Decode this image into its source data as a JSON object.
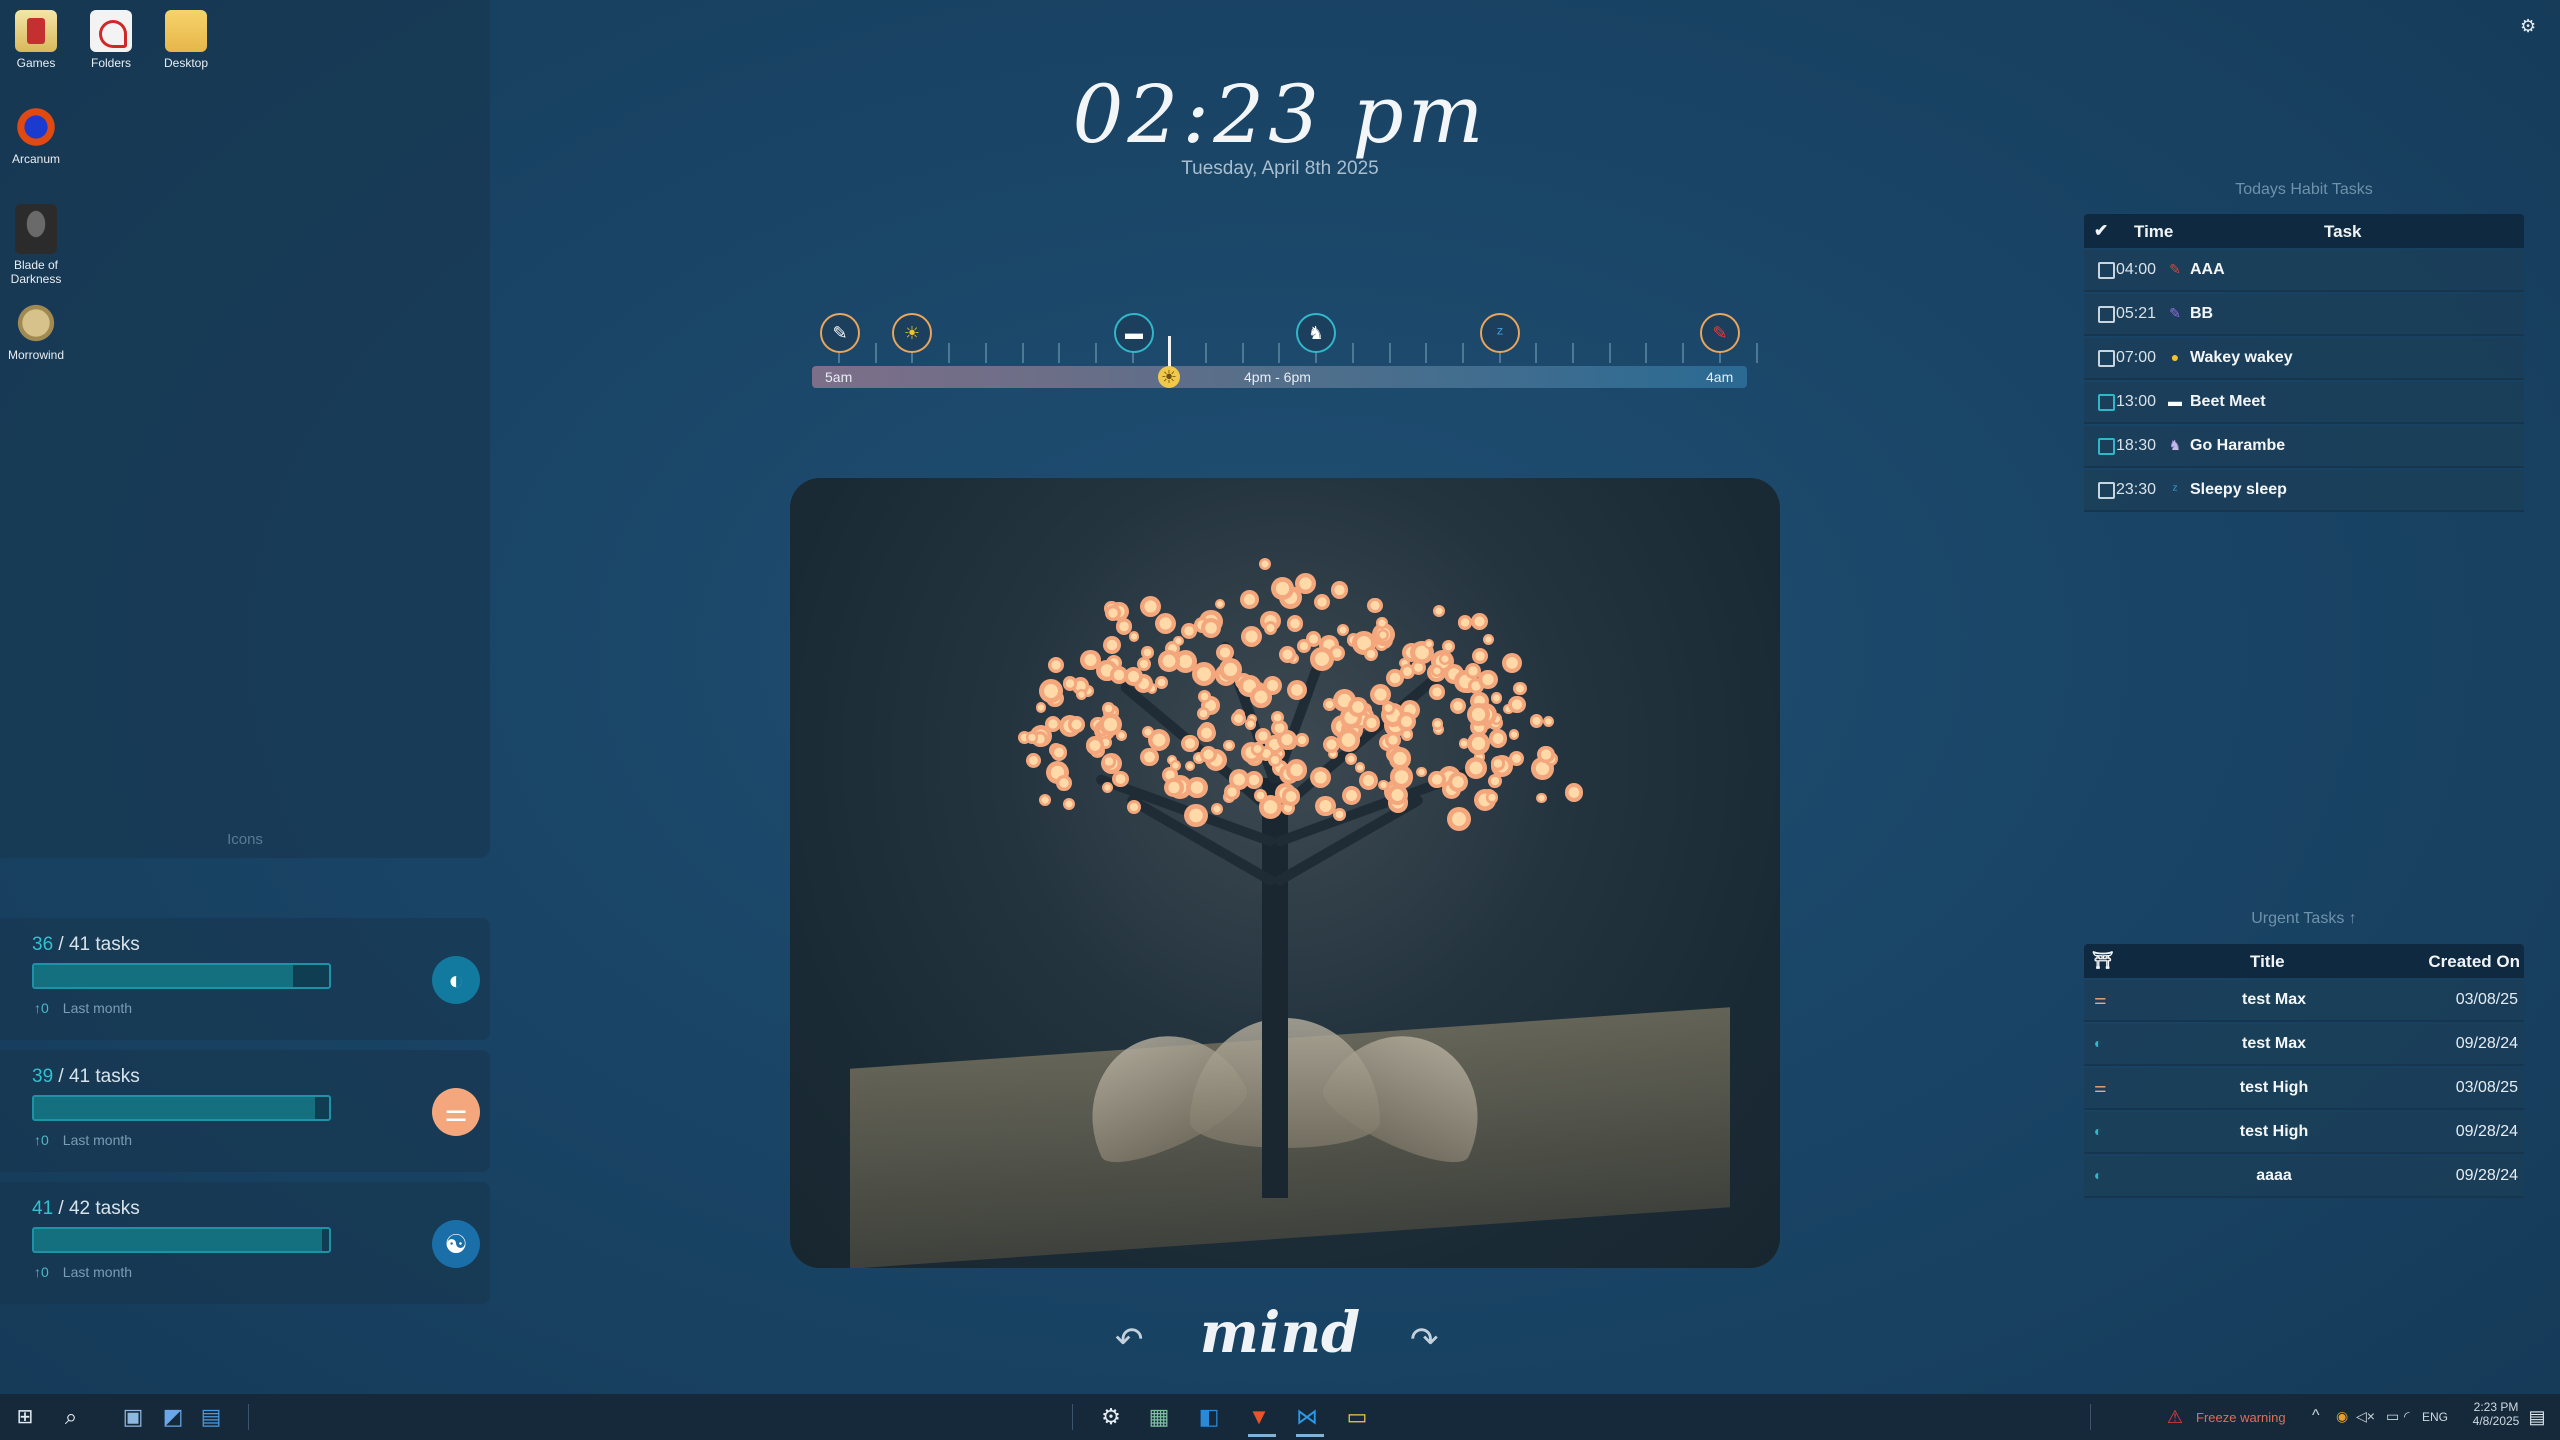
{
  "desktop": {
    "icons": [
      {
        "label": "Games",
        "icon": "games-icon"
      },
      {
        "label": "Folders",
        "icon": "pdf-icon"
      },
      {
        "label": "Desktop",
        "icon": "folder-icon"
      },
      {
        "label": "Arcanum",
        "icon": "arcanum-icon"
      },
      {
        "label": "Blade of Darkness",
        "icon": "blade-of-darkness-icon"
      },
      {
        "label": "Morrowind",
        "icon": "morrowind-icon"
      }
    ],
    "panel_label": "Icons",
    "settings_icon": "gear-icon"
  },
  "progress": [
    {
      "done": "36",
      "total": "41",
      "suffix": "tasks",
      "fraction": 0.878,
      "trend": "↑0",
      "period": "Last month",
      "badge_icon": "brain-icon",
      "badge_glyph": "◐",
      "badge_color": "#117a9e"
    },
    {
      "done": "39",
      "total": "41",
      "suffix": "tasks",
      "fraction": 0.951,
      "trend": "↑0",
      "period": "Last month",
      "badge_icon": "dumbbell-icon",
      "badge_glyph": "⚌",
      "badge_color": "#f4a77c"
    },
    {
      "done": "41",
      "total": "42",
      "suffix": "tasks",
      "fraction": 0.976,
      "trend": "↑0",
      "period": "Last month",
      "badge_icon": "yin-yang-icon",
      "badge_glyph": "☯",
      "badge_color": "#1a6fa8"
    }
  ],
  "clock": {
    "time": "02:23 pm",
    "date": "Tuesday, April 8th 2025"
  },
  "timeline": {
    "start_label": "5am",
    "mid_label": "4pm - 6pm",
    "end_label": "4am",
    "events": [
      {
        "icon": "pencil-icon",
        "glyph": "✎",
        "ring": "orange"
      },
      {
        "icon": "sun-icon",
        "glyph": "☀",
        "ring": "orange"
      },
      {
        "icon": "meeting-icon",
        "glyph": "▬",
        "ring": "teal"
      },
      {
        "icon": "gorilla-icon",
        "glyph": "♞",
        "ring": "teal"
      },
      {
        "icon": "sleep-icon",
        "glyph": "ᶻ",
        "ring": "orange"
      },
      {
        "icon": "pen-icon",
        "glyph": "✎",
        "ring": "orange"
      }
    ]
  },
  "focus": {
    "label": "mind",
    "prev": "↶",
    "next": "↷"
  },
  "habit": {
    "title": "Todays Habit Tasks",
    "headers": {
      "check": "✔",
      "time": "Time",
      "task": "Task"
    },
    "rows": [
      {
        "time": "04:00",
        "task": "AAA",
        "icon": "pen-icon",
        "glyph": "✎",
        "color": "#e0413a",
        "checkbox": "white"
      },
      {
        "time": "05:21",
        "task": "BB",
        "icon": "pencil-icon",
        "glyph": "✎",
        "color": "#9a6ae0",
        "checkbox": "white"
      },
      {
        "time": "07:00",
        "task": "Wakey wakey",
        "icon": "sun-icon",
        "glyph": "●",
        "color": "#f2c230",
        "checkbox": "white"
      },
      {
        "time": "13:00",
        "task": "Beet Meet",
        "icon": "meeting-icon",
        "glyph": "▬",
        "color": "#ffffff",
        "checkbox": "teal"
      },
      {
        "time": "18:30",
        "task": "Go Harambe",
        "icon": "gorilla-icon",
        "glyph": "♞",
        "color": "#c9b8f0",
        "checkbox": "teal"
      },
      {
        "time": "23:30",
        "task": "Sleepy sleep",
        "icon": "sleep-icon",
        "glyph": "ᶻ",
        "color": "#3fa0e0",
        "checkbox": "white"
      }
    ]
  },
  "urgent": {
    "title": "Urgent Tasks",
    "sort_indicator": "↑",
    "headers": {
      "icon": "⛩",
      "title": "Title",
      "created": "Created On"
    },
    "rows": [
      {
        "title": "test Max",
        "date": "03/08/25",
        "icon": "dumbbell-icon",
        "glyph": "⚌",
        "color": "#f4a77c"
      },
      {
        "title": "test Max",
        "date": "09/28/24",
        "icon": "brain-icon",
        "glyph": "◐",
        "color": "#33b8c9"
      },
      {
        "title": "test High",
        "date": "03/08/25",
        "icon": "dumbbell-icon",
        "glyph": "⚌",
        "color": "#f4a77c"
      },
      {
        "title": "test High",
        "date": "09/28/24",
        "icon": "brain-icon",
        "glyph": "◐",
        "color": "#33b8c9"
      },
      {
        "title": "aaaa",
        "date": "09/28/24",
        "icon": "brain-icon",
        "glyph": "◐",
        "color": "#33b8c9"
      }
    ]
  },
  "taskbar": {
    "start_icon": "windows-icon",
    "freeze_warning": "Freeze warning",
    "lang": "ENG",
    "clock_time": "2:23 PM",
    "clock_date": "4/8/2025"
  }
}
